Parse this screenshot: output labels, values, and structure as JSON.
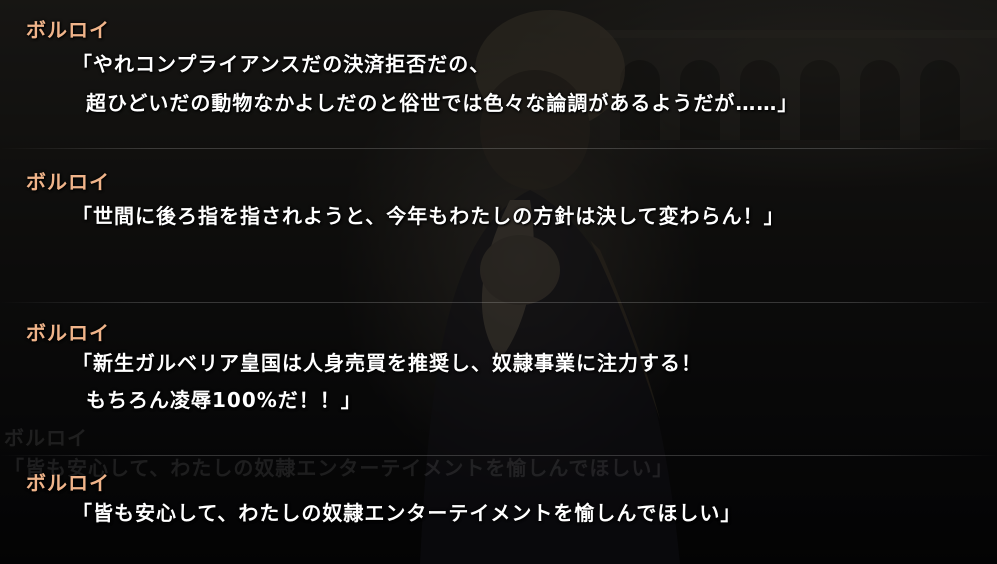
{
  "log": {
    "entries": [
      {
        "speaker": "ボルロイ",
        "lines": [
          "「やれコンプライアンスだの決済拒否だの、",
          "超ひどいだの動物なかよしだのと俗世では色々な論調があるようだが……」"
        ]
      },
      {
        "speaker": "ボルロイ",
        "lines": [
          "「世間に後ろ指を指されようと、今年もわたしの方針は決して変わらん！」"
        ]
      },
      {
        "speaker": "ボルロイ",
        "lines": [
          "「新生ガルベリア皇国は人身売買を推奨し、奴隷事業に注力する！",
          "もちろん凌辱100%だ！！」"
        ]
      },
      {
        "speaker": "ボルロイ",
        "lines": [
          "「皆も安心して、わたしの奴隷エンターテイメントを愉しんでほしい」"
        ]
      }
    ],
    "ghost": {
      "speaker": "ボルロイ",
      "line": "「皆も安心して、わたしの奴隷エンターテイメントを愉しんでほしい」"
    }
  },
  "colors": {
    "speaker": "#f0b48a",
    "text": "#ffffff"
  }
}
